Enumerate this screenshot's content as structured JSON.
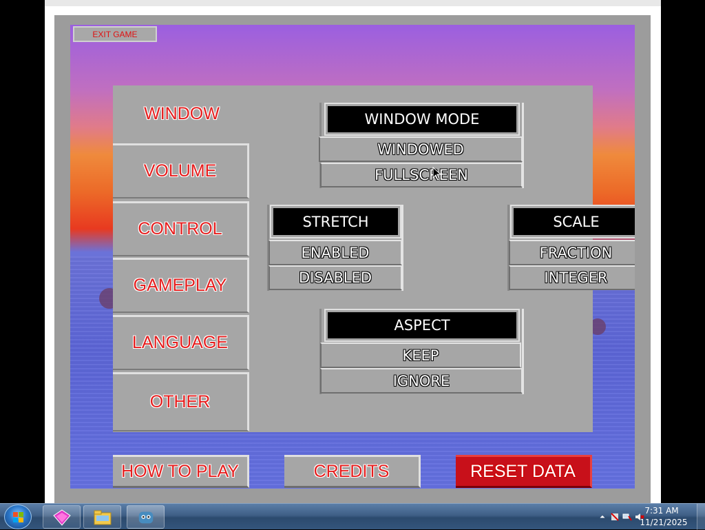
{
  "game": {
    "exit_label": "EXIT GAME"
  },
  "settings": {
    "title": "WINDOW",
    "tabs": [
      {
        "label": "VOLUME"
      },
      {
        "label": "CONTROL"
      },
      {
        "label": "GAMEPLAY"
      },
      {
        "label": "LANGUAGE"
      },
      {
        "label": "OTHER"
      }
    ],
    "window_mode": {
      "header": "WINDOW MODE",
      "options": [
        "WINDOWED",
        "FULLSCREEN"
      ]
    },
    "stretch": {
      "header": "STRETCH",
      "options": [
        "ENABLED",
        "DISABLED"
      ]
    },
    "scale": {
      "header": "SCALE",
      "options": [
        "FRACTION",
        "INTEGER"
      ]
    },
    "aspect": {
      "header": "ASPECT",
      "options": [
        "KEEP",
        "IGNORE"
      ]
    }
  },
  "bottom_buttons": {
    "how_to_play": "HOW TO PLAY",
    "credits": "CREDITS",
    "reset_data": "RESET DATA"
  },
  "taskbar": {
    "time": "7:31 AM",
    "date": "11/21/2025"
  },
  "colors": {
    "accent_red": "#e51d1d",
    "panel_gray": "#a6a6a6",
    "reset_red": "#c8101a"
  }
}
